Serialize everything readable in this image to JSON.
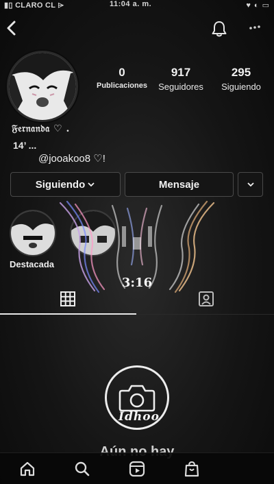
{
  "status_bar": {
    "carrier": "▮▯ CLARO CL ⌲",
    "time": "11:04 a. m.",
    "right": "♥ ◐ ▭"
  },
  "profile": {
    "stats": [
      {
        "value": "0",
        "label": "Publicaciones"
      },
      {
        "value": "917",
        "label": "Seguidores"
      },
      {
        "value": "295",
        "label": "Siguiendo"
      }
    ],
    "name": "𝔉𝔢𝔯𝔫𝔞𝔫𝔡𝔞 ♡ .",
    "bio_line": "14’ ...",
    "mention": "@jooakoo8 ♡!"
  },
  "buttons": {
    "following": "Siguiendo",
    "message": "Mensaje"
  },
  "highlights": [
    {
      "label": "Destacada"
    },
    {
      "label": ""
    }
  ],
  "sticker_text": "3:16",
  "empty_state": {
    "camera_tag": "Idhoo",
    "title": "Aún no hay"
  },
  "icons": {
    "back": "chevron-left",
    "bell": "bell",
    "more": "ellipsis",
    "grid": "grid",
    "tagged": "person-tag",
    "camera": "camera",
    "home": "home",
    "search": "search",
    "reels": "reels",
    "shop": "shop"
  },
  "colors": {
    "background": "#121212",
    "text": "#f2f2f2",
    "border": "#4a4a4a"
  }
}
